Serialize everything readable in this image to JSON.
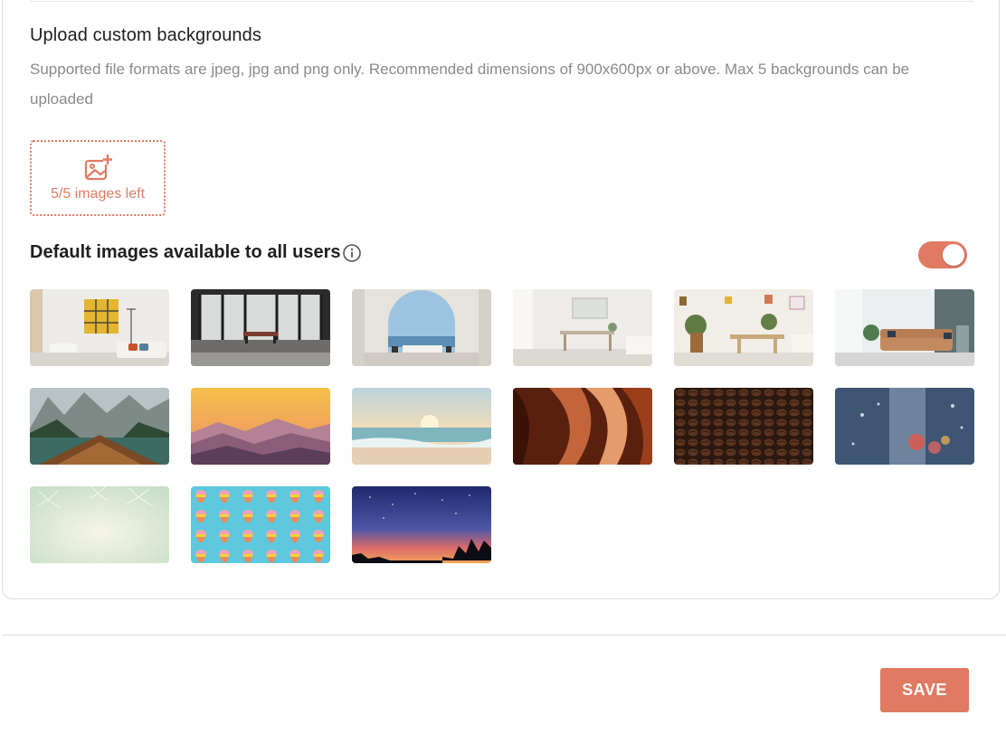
{
  "upload_section": {
    "title": "Upload custom backgrounds",
    "description": "Supported file formats are jpeg, jpg and png only. Recommended dimensions of 900x600px or above. Max 5 backgrounds can be uploaded",
    "upload_label": "5/5 images left",
    "upload_icon": "add-image-icon"
  },
  "default_section": {
    "title": "Default images available to all users",
    "info_icon": "info-icon",
    "toggle_on": true
  },
  "backgrounds": [
    {
      "name": "living-room-yellow-shelf"
    },
    {
      "name": "office-glass-walls"
    },
    {
      "name": "arched-terrace-sea"
    },
    {
      "name": "white-bedroom-desk"
    },
    {
      "name": "dining-room-plants"
    },
    {
      "name": "living-room-sofa"
    },
    {
      "name": "lake-boat-mountains"
    },
    {
      "name": "sunset-mountains"
    },
    {
      "name": "beach-sunrise"
    },
    {
      "name": "canyon"
    },
    {
      "name": "coffee-beans"
    },
    {
      "name": "rainy-window-bokeh"
    },
    {
      "name": "fireworks-mint"
    },
    {
      "name": "pattern-cupcakes"
    },
    {
      "name": "night-sky-sunset"
    }
  ],
  "colors": {
    "accent": "#e07a63",
    "muted_text": "#8a8a8a"
  },
  "footer": {
    "save_label": "SAVE"
  }
}
